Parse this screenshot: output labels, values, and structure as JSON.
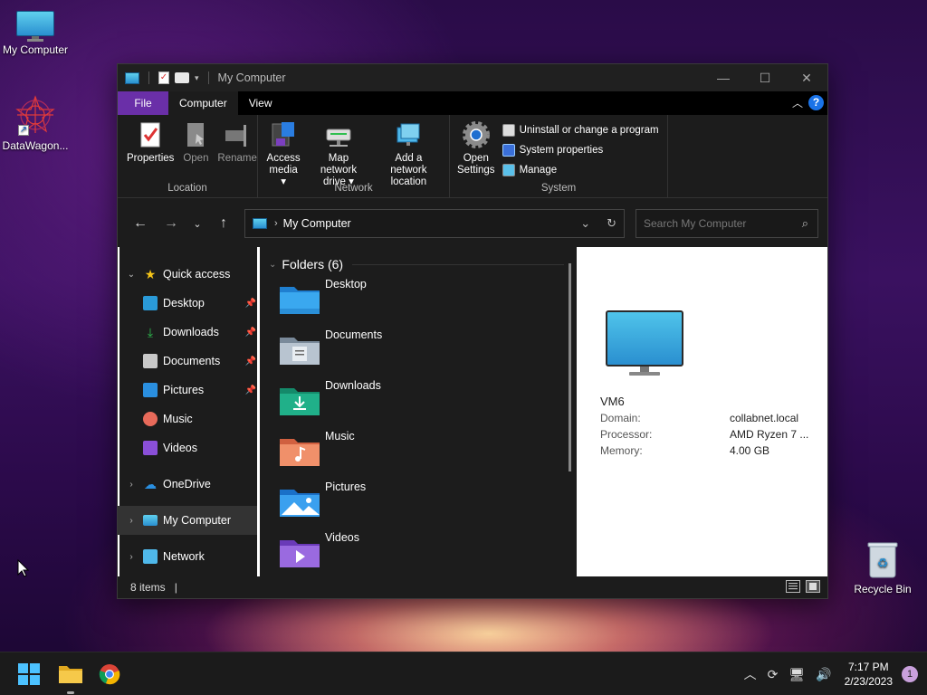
{
  "desktop": {
    "icons": [
      {
        "label": "My Computer"
      },
      {
        "label": "DataWagon..."
      },
      {
        "label": "Recycle Bin"
      }
    ]
  },
  "window": {
    "title": "My Computer",
    "controls": {
      "minimize": "—",
      "maximize": "☐",
      "close": "✕"
    },
    "tabs": {
      "file": "File",
      "computer": "Computer",
      "view": "View"
    },
    "ribbon": {
      "location": {
        "group": "Location",
        "properties": "Properties",
        "open": "Open",
        "rename": "Rename"
      },
      "network": {
        "group": "Network",
        "access_media_1": "Access",
        "access_media_2": "media ▾",
        "map_drive_1": "Map network",
        "map_drive_2": "drive ▾",
        "add_location_1": "Add a network",
        "add_location_2": "location"
      },
      "system": {
        "group": "System",
        "open_settings_1": "Open",
        "open_settings_2": "Settings",
        "uninstall": "Uninstall or change a program",
        "sys_props": "System properties",
        "manage": "Manage"
      }
    },
    "address": {
      "path": "My Computer",
      "search_placeholder": "Search My Computer"
    },
    "nav": {
      "quick_access": "Quick access",
      "items": [
        {
          "label": "Desktop",
          "pinned": true
        },
        {
          "label": "Downloads",
          "pinned": true
        },
        {
          "label": "Documents",
          "pinned": true
        },
        {
          "label": "Pictures",
          "pinned": true
        },
        {
          "label": "Music",
          "pinned": false
        },
        {
          "label": "Videos",
          "pinned": false
        }
      ],
      "onedrive": "OneDrive",
      "my_computer": "My Computer",
      "network": "Network"
    },
    "content": {
      "header": "Folders (6)",
      "folders": [
        "Desktop",
        "Documents",
        "Downloads",
        "Music",
        "Pictures",
        "Videos"
      ]
    },
    "details": {
      "name": "VM6",
      "domain_label": "Domain:",
      "domain_value": "collabnet.local",
      "processor_label": "Processor:",
      "processor_value": "AMD Ryzen 7 ...",
      "memory_label": "Memory:",
      "memory_value": "4.00 GB"
    },
    "status": {
      "count": "8 items",
      "cursor": "|"
    }
  },
  "taskbar": {
    "time": "7:17 PM",
    "date": "2/23/2023",
    "notifications": "1"
  },
  "colors": {
    "file_tab": "#6a2fa8",
    "accent": "#1a73e8",
    "monitor_blue": "#2a8fd0"
  }
}
